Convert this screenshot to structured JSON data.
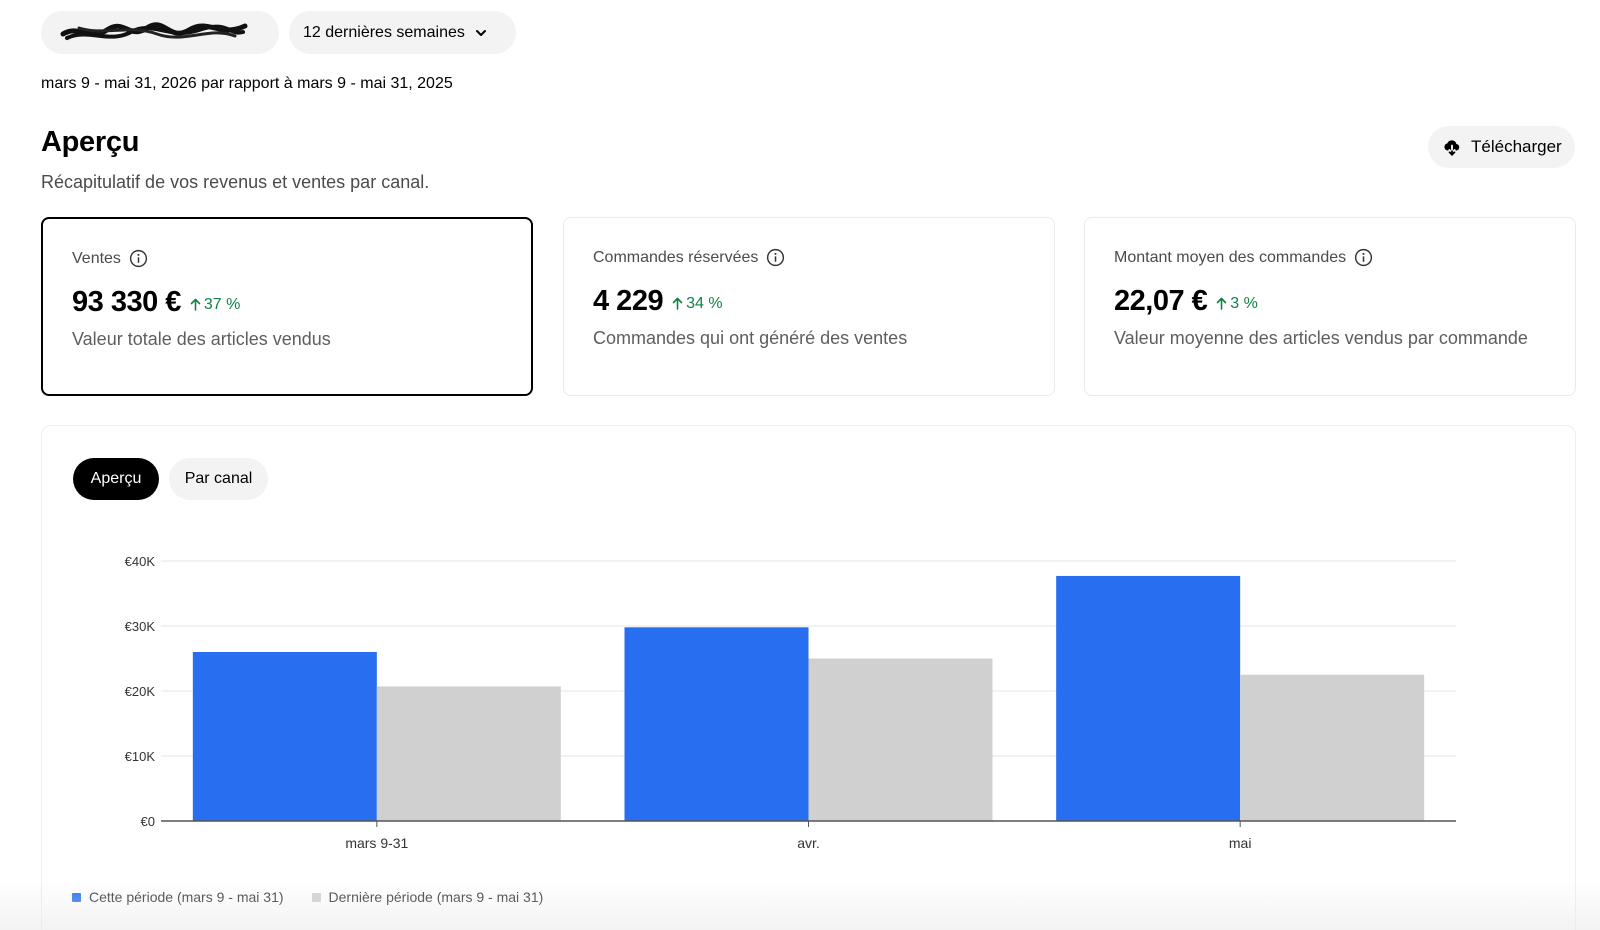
{
  "filters": {
    "store_label": "",
    "period_label": "12 dernières semaines"
  },
  "date_range": "mars 9 - mai 31, 2026 par rapport à mars 9 - mai 31, 2025",
  "overview": {
    "title": "Aperçu",
    "subtitle": "Récapitulatif de vos revenus et ventes par canal.",
    "download_label": "Télécharger"
  },
  "kpis": [
    {
      "label": "Ventes",
      "value": "93 330 €",
      "change": "37 %",
      "description": "Valeur totale des articles vendus",
      "selected": true
    },
    {
      "label": "Commandes réservées",
      "value": "4 229",
      "change": "34 %",
      "description": "Commandes qui ont généré des ventes",
      "selected": false
    },
    {
      "label": "Montant moyen des commandes",
      "value": "22,07 €",
      "change": "3 %",
      "description": "Valeur moyenne des articles vendus par commande",
      "selected": false
    }
  ],
  "chart_tabs": [
    "Aperçu",
    "Par canal"
  ],
  "colors": {
    "current": "#276ef1",
    "previous": "#d0d0d0",
    "positive": "#0e8345"
  },
  "chart_data": {
    "type": "bar",
    "categories": [
      "mars 9-31",
      "avr.",
      "mai"
    ],
    "series": [
      {
        "name": "Cette période (mars 9 - mai 31)",
        "values": [
          26000,
          29800,
          37700
        ]
      },
      {
        "name": "Dernière période (mars 9 - mai 31)",
        "values": [
          20700,
          25000,
          22500
        ]
      }
    ],
    "y_ticks": [
      0,
      10000,
      20000,
      30000,
      40000
    ],
    "y_tick_labels": [
      "€0",
      "€10K",
      "€20K",
      "€30K",
      "€40K"
    ],
    "ylim": [
      0,
      40000
    ],
    "grid": true,
    "legend": "bottom-left",
    "title": "",
    "xlabel": "",
    "ylabel": ""
  }
}
